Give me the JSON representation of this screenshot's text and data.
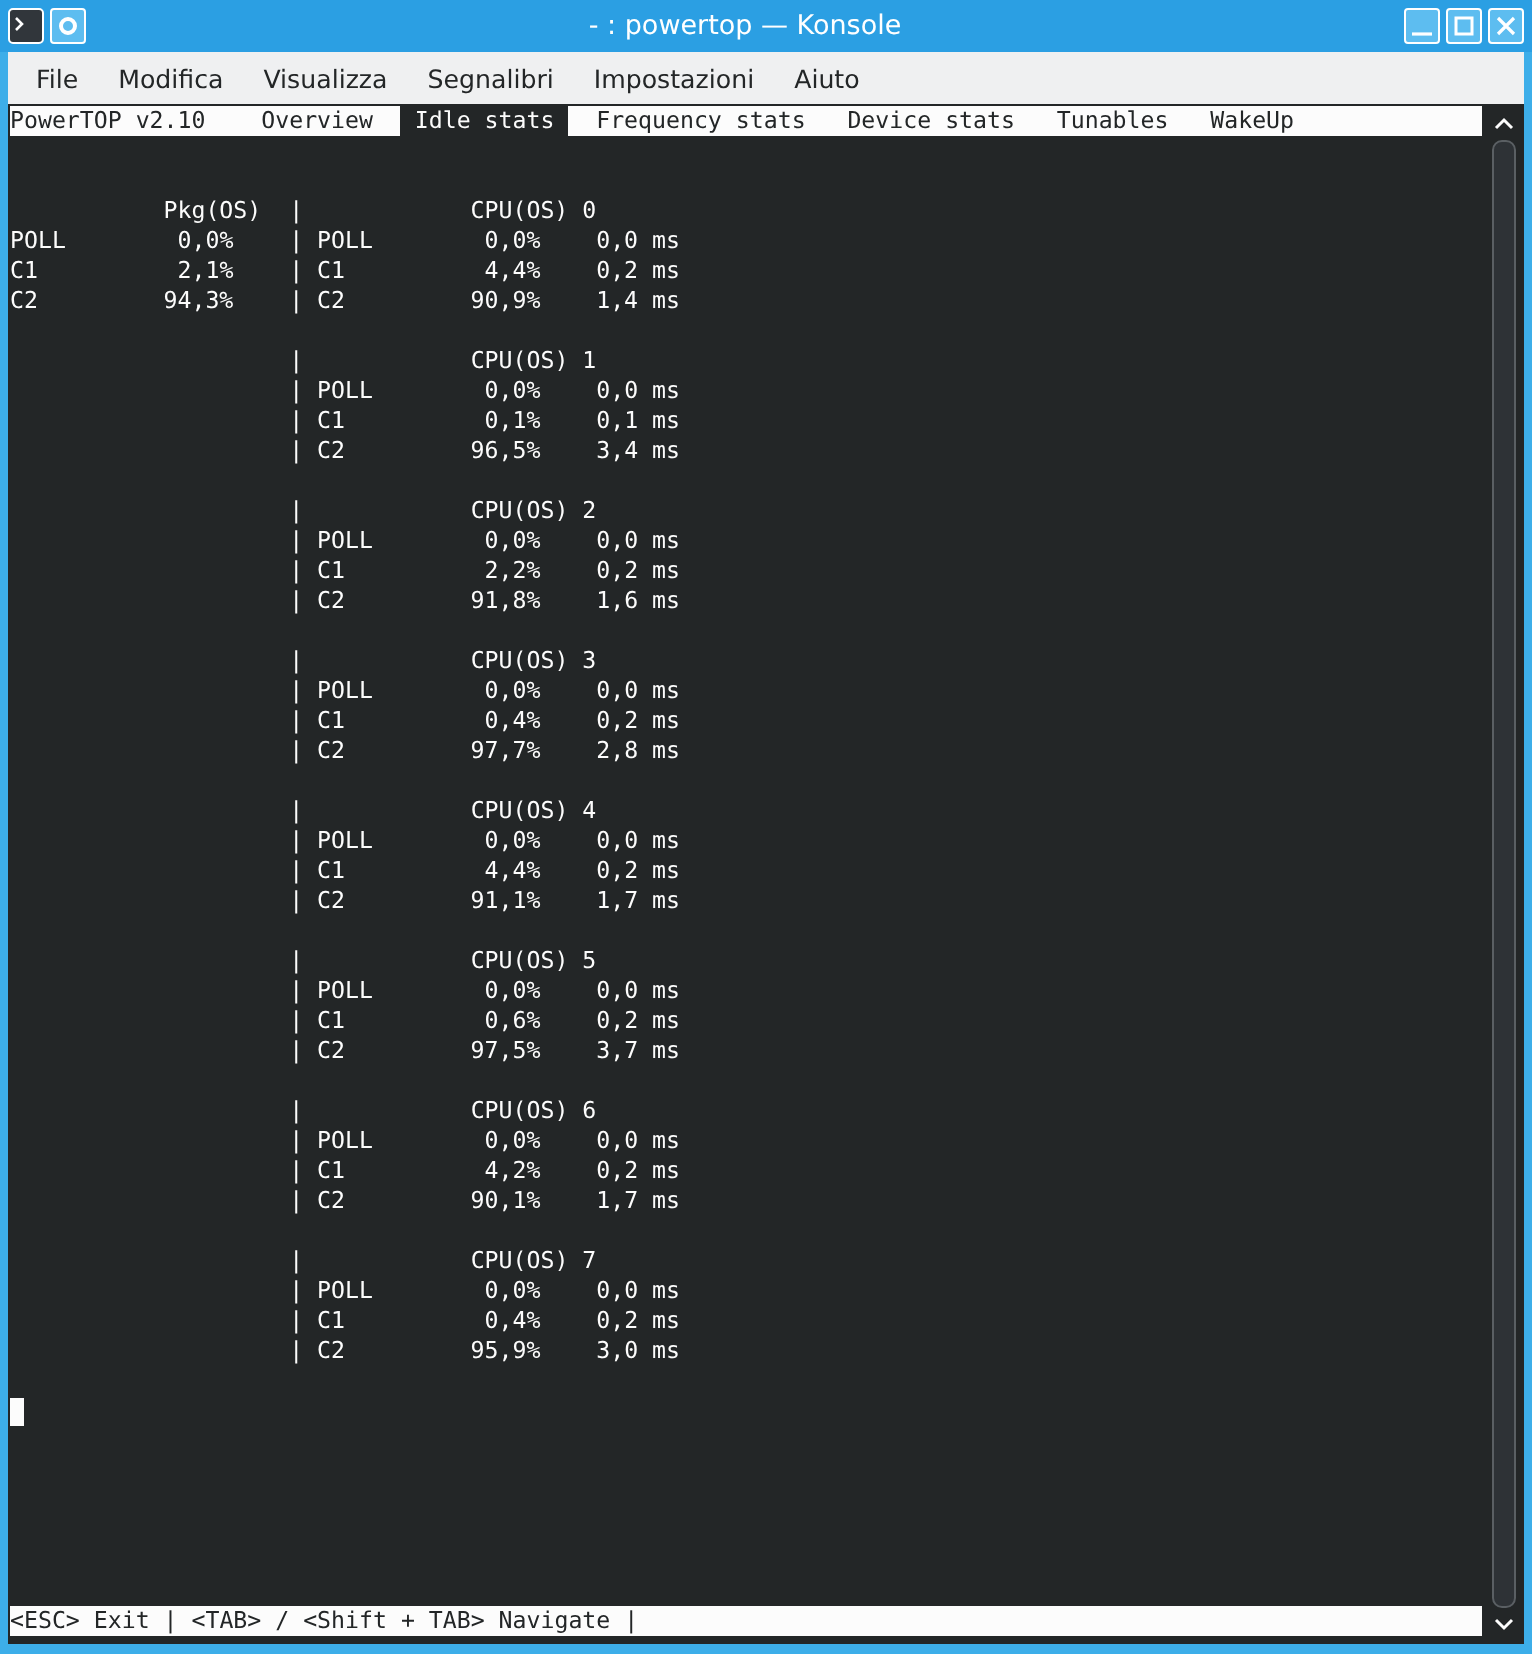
{
  "window": {
    "title": "- : powertop — Konsole"
  },
  "menu": [
    "File",
    "Modifica",
    "Visualizza",
    "Segnalibri",
    "Impostazioni",
    "Aiuto"
  ],
  "powertop": {
    "version": "PowerTOP v2.10",
    "tabs": [
      {
        "label": "Overview",
        "selected": false
      },
      {
        "label": "Idle stats",
        "selected": true
      },
      {
        "label": "Frequency stats",
        "selected": false
      },
      {
        "label": "Device stats",
        "selected": false
      },
      {
        "label": "Tunables",
        "selected": false
      },
      {
        "label": "WakeUp",
        "selected": false
      }
    ],
    "separator": "|",
    "package": {
      "header": "Pkg(OS)",
      "rows": [
        {
          "state": "POLL",
          "residency": "0,0%"
        },
        {
          "state": "C1",
          "residency": "2,1%"
        },
        {
          "state": "C2",
          "residency": "94,3%"
        }
      ]
    },
    "cpus": [
      {
        "header": "CPU(OS) 0",
        "rows": [
          {
            "state": "POLL",
            "residency": "0,0%",
            "duration": "0,0 ms"
          },
          {
            "state": "C1",
            "residency": "4,4%",
            "duration": "0,2 ms"
          },
          {
            "state": "C2",
            "residency": "90,9%",
            "duration": "1,4 ms"
          }
        ]
      },
      {
        "header": "CPU(OS) 1",
        "rows": [
          {
            "state": "POLL",
            "residency": "0,0%",
            "duration": "0,0 ms"
          },
          {
            "state": "C1",
            "residency": "0,1%",
            "duration": "0,1 ms"
          },
          {
            "state": "C2",
            "residency": "96,5%",
            "duration": "3,4 ms"
          }
        ]
      },
      {
        "header": "CPU(OS) 2",
        "rows": [
          {
            "state": "POLL",
            "residency": "0,0%",
            "duration": "0,0 ms"
          },
          {
            "state": "C1",
            "residency": "2,2%",
            "duration": "0,2 ms"
          },
          {
            "state": "C2",
            "residency": "91,8%",
            "duration": "1,6 ms"
          }
        ]
      },
      {
        "header": "CPU(OS) 3",
        "rows": [
          {
            "state": "POLL",
            "residency": "0,0%",
            "duration": "0,0 ms"
          },
          {
            "state": "C1",
            "residency": "0,4%",
            "duration": "0,2 ms"
          },
          {
            "state": "C2",
            "residency": "97,7%",
            "duration": "2,8 ms"
          }
        ]
      },
      {
        "header": "CPU(OS) 4",
        "rows": [
          {
            "state": "POLL",
            "residency": "0,0%",
            "duration": "0,0 ms"
          },
          {
            "state": "C1",
            "residency": "4,4%",
            "duration": "0,2 ms"
          },
          {
            "state": "C2",
            "residency": "91,1%",
            "duration": "1,7 ms"
          }
        ]
      },
      {
        "header": "CPU(OS) 5",
        "rows": [
          {
            "state": "POLL",
            "residency": "0,0%",
            "duration": "0,0 ms"
          },
          {
            "state": "C1",
            "residency": "0,6%",
            "duration": "0,2 ms"
          },
          {
            "state": "C2",
            "residency": "97,5%",
            "duration": "3,7 ms"
          }
        ]
      },
      {
        "header": "CPU(OS) 6",
        "rows": [
          {
            "state": "POLL",
            "residency": "0,0%",
            "duration": "0,0 ms"
          },
          {
            "state": "C1",
            "residency": "4,2%",
            "duration": "0,2 ms"
          },
          {
            "state": "C2",
            "residency": "90,1%",
            "duration": "1,7 ms"
          }
        ]
      },
      {
        "header": "CPU(OS) 7",
        "rows": [
          {
            "state": "POLL",
            "residency": "0,0%",
            "duration": "0,0 ms"
          },
          {
            "state": "C1",
            "residency": "0,4%",
            "duration": "0,2 ms"
          },
          {
            "state": "C2",
            "residency": "95,9%",
            "duration": "3,0 ms"
          }
        ]
      }
    ],
    "status_bar": "<ESC> Exit | <TAB> / <Shift + TAB> Navigate |"
  }
}
